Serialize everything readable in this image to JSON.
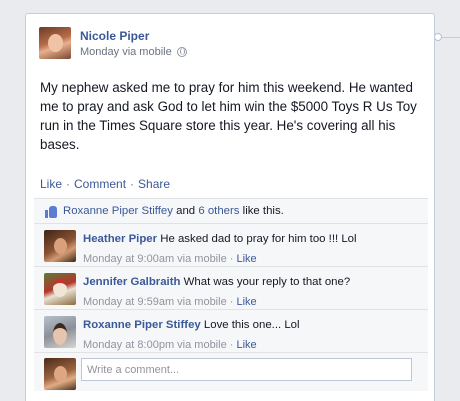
{
  "post": {
    "author": "Nicole Piper",
    "meta": "Monday via mobile",
    "privacy_icon": "globe-icon",
    "text": "My nephew asked me to pray for him this weekend. He wanted me to pray and ask God to let him win the $5000 Toys R Us Toy run in the Times Square store this year. He's covering all his bases."
  },
  "actions": {
    "like": "Like",
    "comment": "Comment",
    "share": "Share",
    "sep": "·"
  },
  "likes": {
    "icon": "thumbs-up-icon",
    "person": "Roxanne Piper Stiffey",
    "and": "and",
    "others": "6 others",
    "suffix": "like this."
  },
  "comments": [
    {
      "name": "Heather Piper",
      "text": "He asked dad to pray for him too !!! Lol",
      "time": "Monday at 9:00am via mobile",
      "like": "Like"
    },
    {
      "name": "Jennifer Galbraith",
      "text": "What was your reply to that one?",
      "time": "Monday at 9:59am via mobile",
      "like": "Like"
    },
    {
      "name": "Roxanne Piper Stiffey",
      "text": "Love this one... Lol",
      "time": "Monday at 8:00pm via mobile",
      "like": "Like"
    }
  ],
  "composer": {
    "placeholder": "Write a comment..."
  },
  "colors": {
    "link": "#3b5998",
    "background": "#e9ebee",
    "feedback_bg": "#f6f7f9"
  }
}
